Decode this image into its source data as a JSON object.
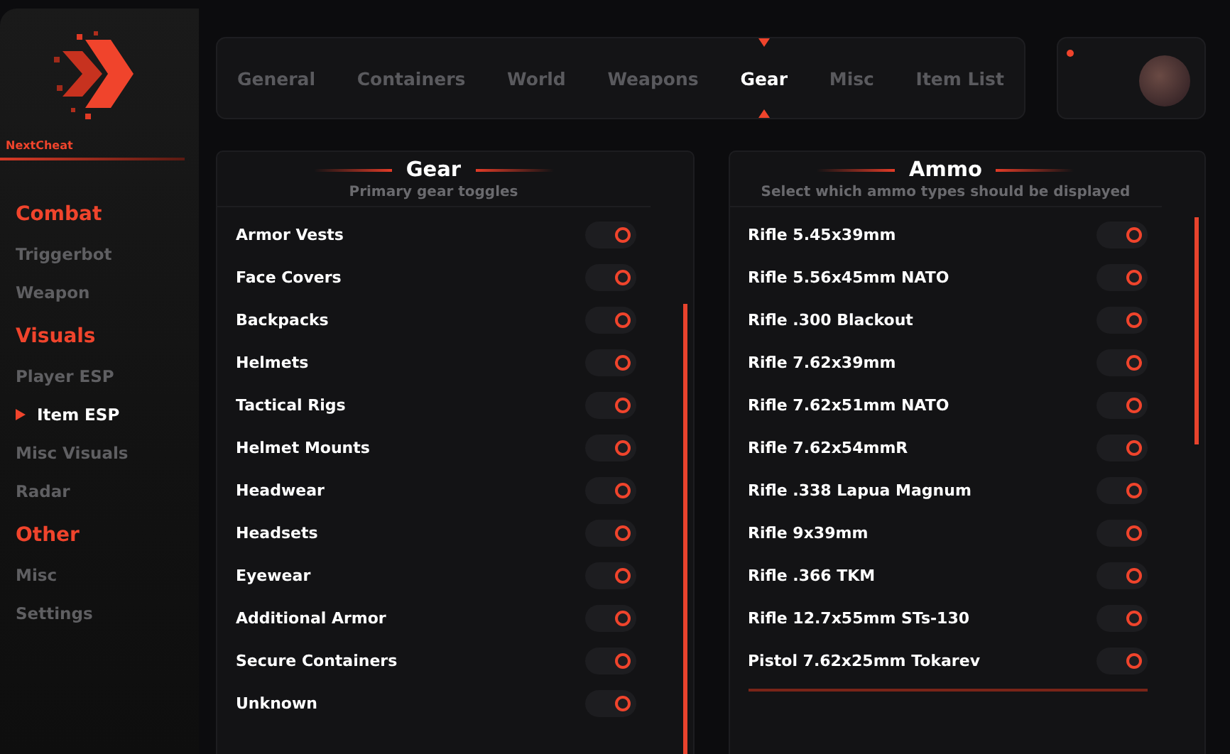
{
  "brand": {
    "name": "NextCheat"
  },
  "sidebar": {
    "sections": [
      {
        "title": "Combat",
        "items": [
          {
            "label": "Triggerbot",
            "selected": false
          },
          {
            "label": "Weapon",
            "selected": false
          }
        ]
      },
      {
        "title": "Visuals",
        "items": [
          {
            "label": "Player ESP",
            "selected": false
          },
          {
            "label": "Item ESP",
            "selected": true
          },
          {
            "label": "Misc Visuals",
            "selected": false
          },
          {
            "label": "Radar",
            "selected": false
          }
        ]
      },
      {
        "title": "Other",
        "items": [
          {
            "label": "Misc",
            "selected": false
          },
          {
            "label": "Settings",
            "selected": false
          }
        ]
      }
    ]
  },
  "tabs": [
    {
      "label": "General",
      "selected": false
    },
    {
      "label": "Containers",
      "selected": false
    },
    {
      "label": "World",
      "selected": false
    },
    {
      "label": "Weapons",
      "selected": false
    },
    {
      "label": "Gear",
      "selected": true
    },
    {
      "label": "Misc",
      "selected": false
    },
    {
      "label": "Item List",
      "selected": false
    }
  ],
  "profile": {
    "online": true
  },
  "panels": [
    {
      "title": "Gear",
      "subtitle": "Primary gear toggles",
      "rows": [
        {
          "label": "Armor Vests",
          "on": true
        },
        {
          "label": "Face Covers",
          "on": true
        },
        {
          "label": "Backpacks",
          "on": true
        },
        {
          "label": "Helmets",
          "on": true
        },
        {
          "label": "Tactical Rigs",
          "on": true
        },
        {
          "label": "Helmet Mounts",
          "on": true
        },
        {
          "label": "Headwear",
          "on": true
        },
        {
          "label": "Headsets",
          "on": true
        },
        {
          "label": "Eyewear",
          "on": true
        },
        {
          "label": "Additional Armor",
          "on": true
        },
        {
          "label": "Secure Containers",
          "on": true
        },
        {
          "label": "Unknown",
          "on": true
        }
      ]
    },
    {
      "title": "Ammo",
      "subtitle": "Select which ammo types should be displayed",
      "rows": [
        {
          "label": "Rifle 5.45x39mm",
          "on": true
        },
        {
          "label": "Rifle 5.56x45mm NATO",
          "on": true
        },
        {
          "label": "Rifle .300 Blackout",
          "on": true
        },
        {
          "label": "Rifle 7.62x39mm",
          "on": true
        },
        {
          "label": "Rifle 7.62x51mm NATO",
          "on": true
        },
        {
          "label": "Rifle 7.62x54mmR",
          "on": true
        },
        {
          "label": "Rifle .338 Lapua Magnum",
          "on": true
        },
        {
          "label": "Rifle 9x39mm",
          "on": true
        },
        {
          "label": "Rifle .366 TKM",
          "on": true
        },
        {
          "label": "Rifle 12.7x55mm STs-130",
          "on": true
        },
        {
          "label": "Pistol 7.62x25mm Tokarev",
          "on": true
        }
      ]
    }
  ]
}
